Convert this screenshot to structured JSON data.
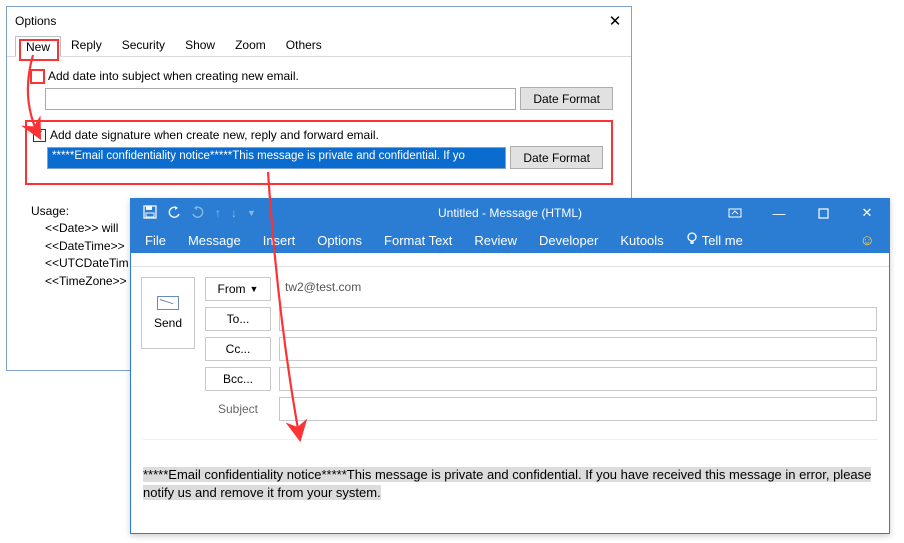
{
  "options": {
    "title": "Options",
    "tabs": [
      "New",
      "Reply",
      "Security",
      "Show",
      "Zoom",
      "Others"
    ],
    "add_date_subject_label": "Add date into subject when creating new email.",
    "date_format_btn": "Date Format",
    "add_signature_label": "Add date signature when create new, reply and forward email.",
    "signature_value": "*****Email confidentiality notice*****This message is private and confidential. If yo",
    "usage_label": "Usage:",
    "usage_lines": [
      "<<Date>> will",
      "<<DateTime>>",
      "<<UTCDateTim",
      "<<TimeZone>>"
    ]
  },
  "compose": {
    "title": "Untitled  -  Message (HTML)",
    "ribbon_tabs": [
      "File",
      "Message",
      "Insert",
      "Options",
      "Format Text",
      "Review",
      "Developer",
      "Kutools"
    ],
    "tell_me": "Tell me",
    "send": "Send",
    "from_label": "From",
    "from_value": "tw2@test.com",
    "to_label": "To...",
    "cc_label": "Cc...",
    "bcc_label": "Bcc...",
    "subject_label": "Subject",
    "body_text": "*****Email confidentiality notice*****This message is private and confidential. If you have received this message in error, please notify us and remove it from your system."
  }
}
